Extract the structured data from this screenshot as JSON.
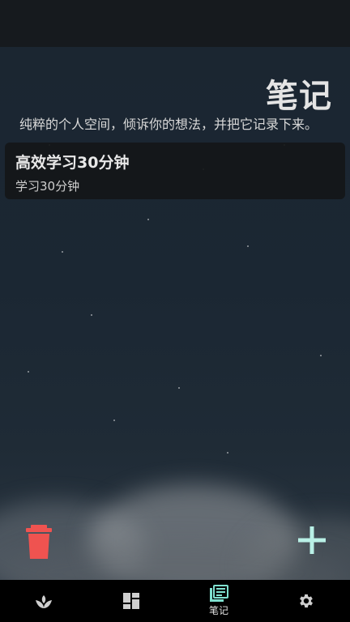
{
  "header": {
    "title": "笔记",
    "subtitle": "纯粹的个人空间，倾诉你的想法，并把它记录下来。"
  },
  "notes": [
    {
      "title": "高效学习30分钟",
      "body": "学习30分钟"
    }
  ],
  "actions": {
    "delete_icon": "trash-icon",
    "add_icon": "plus-icon",
    "delete_color": "#ef5350",
    "add_color": "#b9f0e6"
  },
  "bottom_nav": {
    "items": [
      {
        "icon": "sprout-icon",
        "label": ""
      },
      {
        "icon": "dashboard-icon",
        "label": ""
      },
      {
        "icon": "notes-icon",
        "label": "笔记",
        "active": true
      },
      {
        "icon": "gear-icon",
        "label": ""
      }
    ],
    "active_color": "#7fe0cf",
    "inactive_color": "#cfcfcf"
  }
}
